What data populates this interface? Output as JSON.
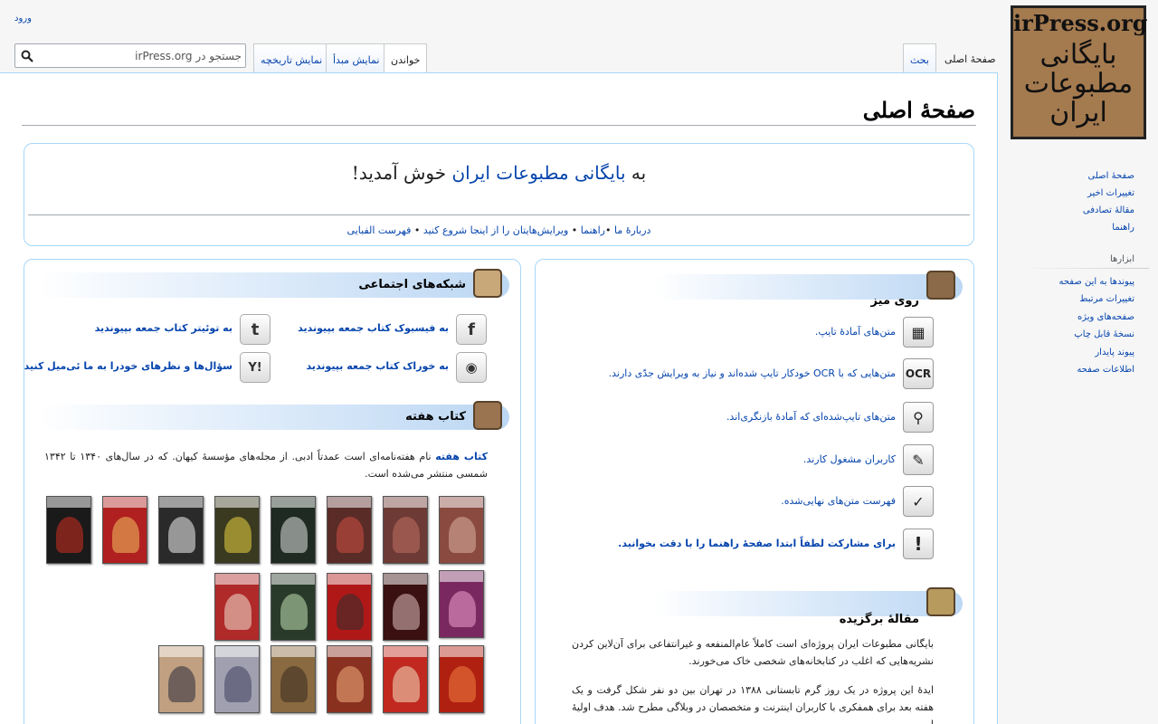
{
  "header": {
    "login": "ورود",
    "search_placeholder": "جستجو در irPress.org",
    "tabs": {
      "main_page": "صفحهٔ اصلی",
      "talk": "بحث",
      "read": "خواندن",
      "view_source": "نمایش مبدأ",
      "view_history": "نمایش تاریخچه"
    }
  },
  "logo": {
    "top": "irPress.org",
    "fa": "بایگانی مطبوعات ایران"
  },
  "sidebar": {
    "nav": [
      "صفحهٔ اصلی",
      "تغییرات اخیر",
      "مقالهٔ تصادفی",
      "راهنما"
    ],
    "tools_heading": "ابزارها",
    "tools": [
      "پیوندها به این صفحه",
      "تغییرات مرتبط",
      "صفحه‌های ویژه",
      "نسخهٔ قابل چاپ",
      "پیوند پایدار",
      "اطلاعات صفحه"
    ]
  },
  "page": {
    "title": "صفحهٔ اصلی",
    "welcome": {
      "pre": "به ",
      "link": "بایگانی مطبوعات ایران",
      "post": " خوش آمدید!",
      "links": [
        "دربارهٔ ما",
        "راهنما",
        "ویرایش‌هایتان را از اینجا شروع کنید",
        "فهرست الفبایی"
      ]
    },
    "desk": {
      "title": "روی میز",
      "items": [
        {
          "icon": "typing-icon",
          "text": "متن‌های آمادهٔ تایپ."
        },
        {
          "icon": "ocr-icon",
          "text": "متن‌هایی که با OCR خودکار تایپ شده‌اند و نیاز به ویرایش جدّی دارند."
        },
        {
          "icon": "magnifier-icon",
          "text": "متن‌های تایپ‌شده‌ای که آمادهٔ بازنگری‌اند."
        },
        {
          "icon": "user-working-icon",
          "text": "کاربران مشغول کارند."
        },
        {
          "icon": "checkmark-icon",
          "text": "فهرست متن‌های نهایی‌شده."
        },
        {
          "icon": "exclamation-icon",
          "text": "برای مشارکت لطفاً ابتدا صفحهٔ راهنما را با دقت بخوانید."
        }
      ]
    },
    "featured": {
      "title": "مقالهٔ برگزیده",
      "p1": "بایگانی مطبوعات ایران پروژه‌ای است کاملاً عام‌المنفعه و غیرانتفاعی برای آن‌لاین کردن نشریه‌هایی که اغلب در کتابخانه‌های شخصی خاک می‌خورند.",
      "p2": "ایدهٔ این پروژه در یک روز گرم تابستانی ۱۳۸۸ در تهران بین دو نفر شکل گرفت و یک هفته بعد برای همفکری با کاربران اینترنت و متخصصان در وبلاگی مطرح شد. هدف اولیهٔ این"
    },
    "social": {
      "title": "شبکه‌های اجتماعی",
      "items": [
        {
          "icon": "facebook-icon",
          "glyph": "f",
          "text": "به فیسبوک کتاب جمعه بپیوندید"
        },
        {
          "icon": "twitter-icon",
          "glyph": "t",
          "text": "به توئیتر کتاب جمعه بپیوندید"
        },
        {
          "icon": "rss-icon",
          "glyph": "◉",
          "text": "به خوراک کتاب جمعه بپیوندید"
        },
        {
          "icon": "yahoo-answers-icon",
          "glyph": "Y!",
          "text": "سؤال‌ها و نظرهای خودرا به ما ئی‌میل کنید"
        }
      ]
    },
    "book": {
      "title": "کتاب هفته",
      "bold": "کتاب هفته",
      "text": " نام هفته‌نامه‌ای است عمدتاً ادبی. از مجله‌های مؤسسهٔ کیهان. که در سال‌های ۱۳۴۰ تا ۱۳۴۲ شمسی منتشر می‌شده است."
    }
  },
  "colors": {
    "link": "#0645ad",
    "box_border": "#a7d7f9",
    "section_gradient": "#bcd7f3",
    "logo_bg": "#a47a4f"
  }
}
